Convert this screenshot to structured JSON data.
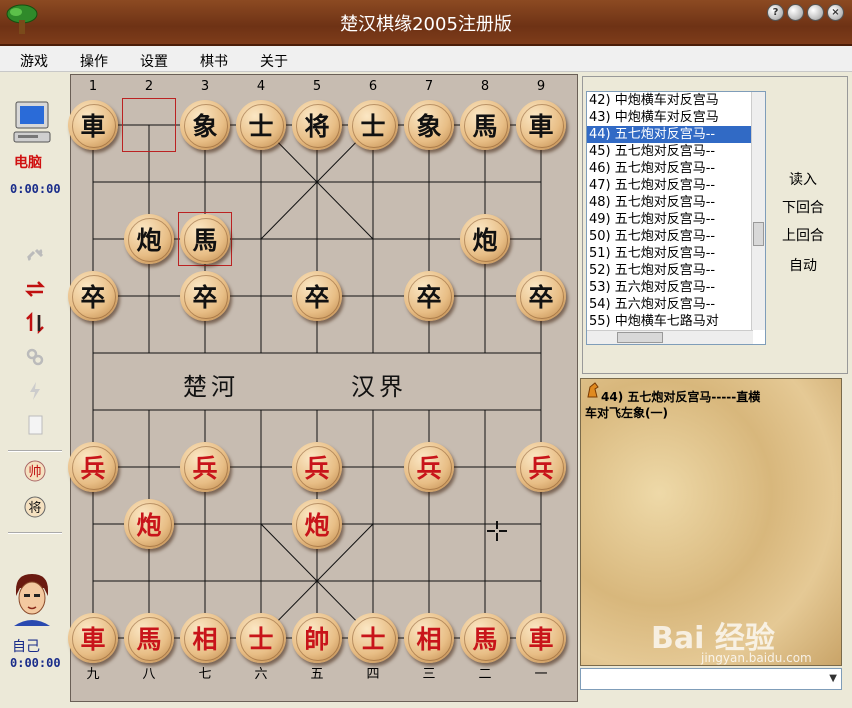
{
  "window": {
    "title": "楚汉棋缘2005注册版",
    "buttons": [
      "?",
      "",
      "",
      "×"
    ]
  },
  "menu": [
    "游戏",
    "操作",
    "设置",
    "棋书",
    "关于"
  ],
  "left_panel": {
    "computer_label": "电脑",
    "computer_time": "0:00:00",
    "self_label": "自己",
    "self_time": "0:00:00"
  },
  "board": {
    "top_numbers": [
      "1",
      "2",
      "3",
      "4",
      "5",
      "6",
      "7",
      "8",
      "9"
    ],
    "bottom_numbers": [
      "九",
      "八",
      "七",
      "六",
      "五",
      "四",
      "三",
      "二",
      "一"
    ],
    "river_left": "楚河",
    "river_right": "汉界",
    "pieces": [
      {
        "c": 0,
        "r": 0,
        "t": "車",
        "side": "black"
      },
      {
        "c": 2,
        "r": 0,
        "t": "象",
        "side": "black"
      },
      {
        "c": 3,
        "r": 0,
        "t": "士",
        "side": "black"
      },
      {
        "c": 4,
        "r": 0,
        "t": "将",
        "side": "black"
      },
      {
        "c": 5,
        "r": 0,
        "t": "士",
        "side": "black"
      },
      {
        "c": 6,
        "r": 0,
        "t": "象",
        "side": "black"
      },
      {
        "c": 7,
        "r": 0,
        "t": "馬",
        "side": "black"
      },
      {
        "c": 8,
        "r": 0,
        "t": "車",
        "side": "black"
      },
      {
        "c": 1,
        "r": 2,
        "t": "炮",
        "side": "black"
      },
      {
        "c": 2,
        "r": 2,
        "t": "馬",
        "side": "black"
      },
      {
        "c": 7,
        "r": 2,
        "t": "炮",
        "side": "black"
      },
      {
        "c": 0,
        "r": 3,
        "t": "卒",
        "side": "black"
      },
      {
        "c": 2,
        "r": 3,
        "t": "卒",
        "side": "black"
      },
      {
        "c": 4,
        "r": 3,
        "t": "卒",
        "side": "black"
      },
      {
        "c": 6,
        "r": 3,
        "t": "卒",
        "side": "black"
      },
      {
        "c": 8,
        "r": 3,
        "t": "卒",
        "side": "black"
      },
      {
        "c": 0,
        "r": 6,
        "t": "兵",
        "side": "red"
      },
      {
        "c": 2,
        "r": 6,
        "t": "兵",
        "side": "red"
      },
      {
        "c": 4,
        "r": 6,
        "t": "兵",
        "side": "red"
      },
      {
        "c": 6,
        "r": 6,
        "t": "兵",
        "side": "red"
      },
      {
        "c": 8,
        "r": 6,
        "t": "兵",
        "side": "red"
      },
      {
        "c": 1,
        "r": 7,
        "t": "炮",
        "side": "red"
      },
      {
        "c": 4,
        "r": 7,
        "t": "炮",
        "side": "red"
      },
      {
        "c": 0,
        "r": 9,
        "t": "車",
        "side": "red"
      },
      {
        "c": 1,
        "r": 9,
        "t": "馬",
        "side": "red"
      },
      {
        "c": 2,
        "r": 9,
        "t": "相",
        "side": "red"
      },
      {
        "c": 3,
        "r": 9,
        "t": "士",
        "side": "red"
      },
      {
        "c": 4,
        "r": 9,
        "t": "帥",
        "side": "red"
      },
      {
        "c": 5,
        "r": 9,
        "t": "士",
        "side": "red"
      },
      {
        "c": 6,
        "r": 9,
        "t": "相",
        "side": "red"
      },
      {
        "c": 7,
        "r": 9,
        "t": "馬",
        "side": "red"
      },
      {
        "c": 8,
        "r": 9,
        "t": "車",
        "side": "red"
      }
    ],
    "last_move_from": {
      "c": 1,
      "r": 0
    },
    "last_move_to": {
      "c": 2,
      "r": 2
    }
  },
  "move_list": {
    "items": [
      "42) 中炮横车对反宫马",
      "43) 中炮横车对反宫马",
      "44) 五七炮对反宫马--",
      "45) 五七炮对反宫马--",
      "46) 五七炮对反宫马--",
      "47) 五七炮对反宫马--",
      "48) 五七炮对反宫马--",
      "49) 五七炮对反宫马--",
      "50) 五七炮对反宫马--",
      "51) 五七炮对反宫马--",
      "52) 五七炮对反宫马--",
      "53) 五六炮对反宫马--",
      "54) 五六炮对反宫马--",
      "55) 中炮横车七路马对"
    ],
    "selected_index": 2,
    "buttons": [
      "读入",
      "下回合",
      "上回合",
      "自动"
    ]
  },
  "comment": {
    "line1": "44) 五七炮对反宫马-----直横",
    "line2": "车对飞左象(一)"
  },
  "watermark": {
    "text": "Bai 经验",
    "sub": "jingyan.baidu.com"
  },
  "colors": {
    "frame": "#7a3b1c",
    "red_piece": "#c8141a",
    "black_piece": "#111111",
    "board": "#c7bcb1",
    "selection": "#316ac5"
  }
}
